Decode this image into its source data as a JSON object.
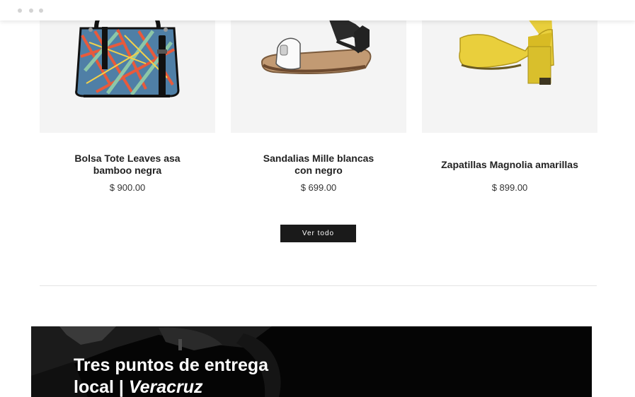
{
  "products": [
    {
      "title": "Bolsa Tote Leaves asa bamboo negra",
      "price": "$ 900.00",
      "image": "tote-bag-leaves"
    },
    {
      "title": "Sandalias Mille blancas con negro",
      "price": "$ 699.00",
      "image": "sandal-white-black"
    },
    {
      "title": "Zapatillas Magnolia amarillas",
      "price": "$ 899.00",
      "image": "yellow-platform-heel"
    }
  ],
  "cta": {
    "label": "Ver todo"
  },
  "banner": {
    "title_line1": "Tres puntos de entrega",
    "title_line2_a": "local | ",
    "title_line2_b": "Veracruz"
  },
  "colors": {
    "button_bg": "#1a1a1a",
    "image_bg": "#f4f4f4",
    "banner_bg": "#050505",
    "accent_yellow": "#e9cf3c"
  }
}
